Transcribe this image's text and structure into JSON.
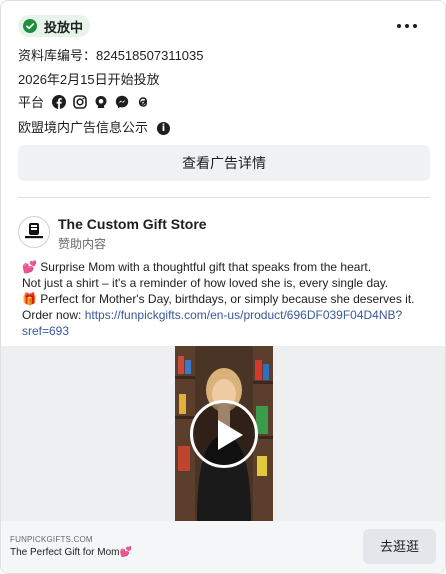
{
  "status": {
    "label": "投放中"
  },
  "library_id": "资料库编号：824518507311035",
  "start_date": "2026年2月15日开始投放",
  "platforms": {
    "label": "平台",
    "icons": [
      "facebook-icon",
      "instagram-icon",
      "audience-network-icon",
      "messenger-icon",
      "threads-icon"
    ]
  },
  "eu_transparency": "欧盟境内广告信息公示",
  "details_button": "查看广告详情",
  "advertiser": {
    "name": "The Custom Gift Store",
    "sponsored": "赞助内容"
  },
  "ad_body": {
    "line1": "💕 Surprise Mom with a thoughtful gift that speaks from the heart.",
    "line2": "Not just a shirt – it's a reminder of how loved she is, every single day.",
    "line3": "🎁 Perfect for Mother's Day, birthdays, or simply because she deserves it.",
    "order_prefix": "Order now: ",
    "link": "https://funpickgifts.com/en-us/product/696DF039F04D4NB?sref=693"
  },
  "link_preview": {
    "domain": "FUNPICKGIFTS.COM",
    "title": "The Perfect Gift for Mom💕",
    "cta": "去逛逛"
  },
  "colors": {
    "status_bg": "#e6f4ea",
    "status_check": "#1e8e3e",
    "link": "#385898"
  }
}
